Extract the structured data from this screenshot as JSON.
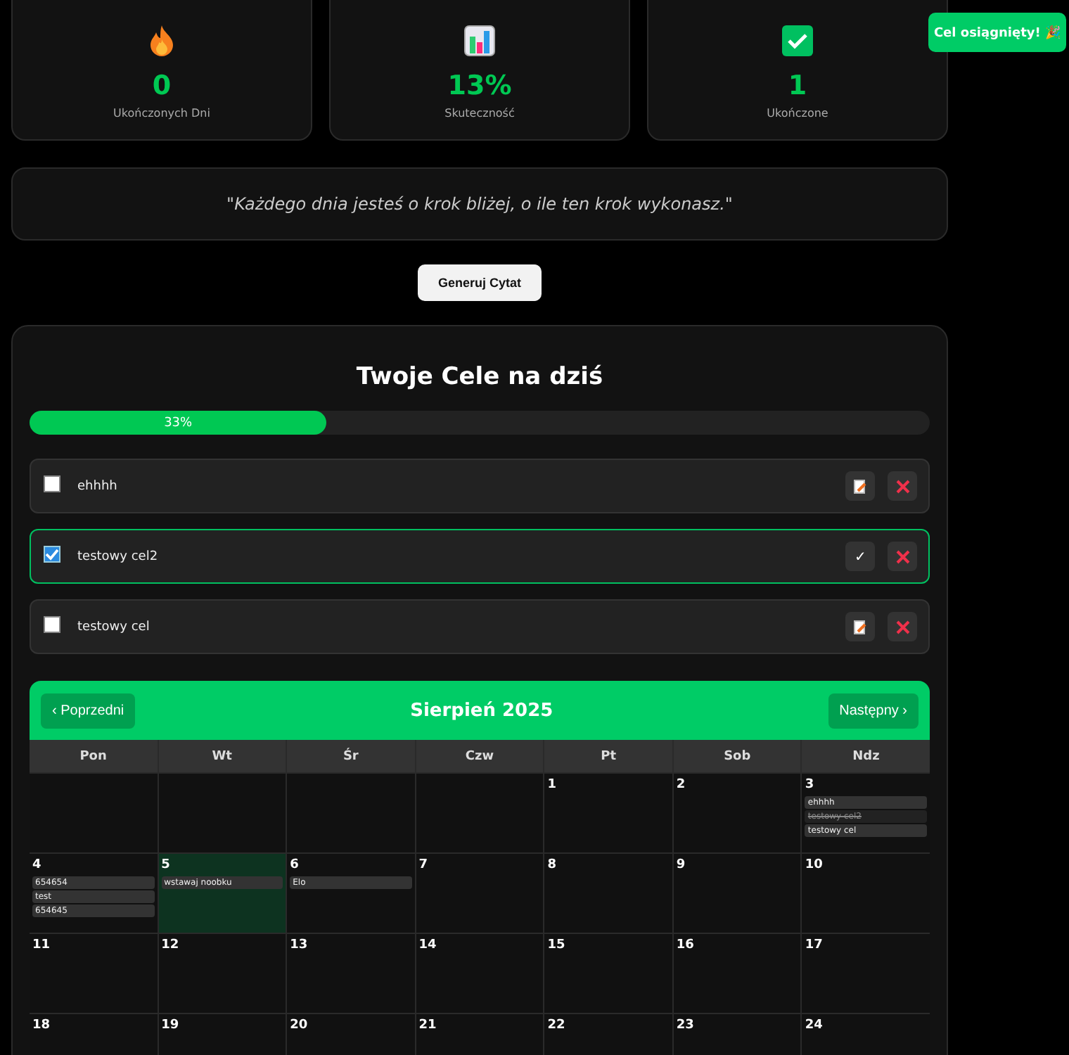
{
  "stats": [
    {
      "kind": "flame",
      "value": "0",
      "label": "Ukończonych Dni"
    },
    {
      "kind": "chart",
      "value": "13%",
      "label": "Skuteczność"
    },
    {
      "kind": "check",
      "value": "1",
      "label": "Ukończone"
    }
  ],
  "toast": {
    "text": "Cel osiągnięty! 🎉"
  },
  "quote": {
    "text": "\"Każdego dnia jesteś o krok bliżej, o ile ten krok wykonasz.\""
  },
  "quote_button": "Generuj Cytat",
  "goals_panel": {
    "title": "Twoje Cele na dziś",
    "progress": {
      "level": 0.33,
      "label": "33%"
    },
    "goals": [
      {
        "text": "ehhhh",
        "checked": false
      },
      {
        "text": "testowy cel2",
        "checked": true,
        "done_mark": "✓"
      },
      {
        "text": "testowy cel",
        "checked": false
      }
    ]
  },
  "calendar": {
    "title": "Sierpień 2025",
    "prev": "‹ Poprzedni",
    "next": "Następny ›",
    "weekdays": [
      "Pon",
      "Wt",
      "Śr",
      "Czw",
      "Pt",
      "Sob",
      "Ndz"
    ],
    "weeks": [
      [
        {
          "kind": "blank"
        },
        {
          "kind": "blank"
        },
        {
          "kind": "blank"
        },
        {
          "kind": "blank"
        },
        {
          "kind": "day",
          "day": "1",
          "today": false
        },
        {
          "kind": "day",
          "day": "2",
          "today": false
        },
        {
          "kind": "day",
          "day": "3",
          "today": false,
          "tasks": [
            {
              "text": "ehhhh",
              "done": false
            },
            {
              "text": "testowy cel2",
              "done": true
            },
            {
              "text": "testowy cel",
              "done": false
            }
          ]
        }
      ],
      [
        {
          "kind": "day",
          "day": "4",
          "today": false,
          "tasks": [
            {
              "text": "654654",
              "done": false
            },
            {
              "text": "test",
              "done": false
            },
            {
              "text": "654645",
              "done": false
            }
          ]
        },
        {
          "kind": "day",
          "day": "5",
          "today": true,
          "tasks": [
            {
              "text": "wstawaj noobku",
              "done": false
            }
          ]
        },
        {
          "kind": "day",
          "day": "6",
          "today": false,
          "tasks": [
            {
              "text": "Elo",
              "done": false
            }
          ]
        },
        {
          "kind": "day",
          "day": "7",
          "today": false
        },
        {
          "kind": "day",
          "day": "8",
          "today": false
        },
        {
          "kind": "day",
          "day": "9",
          "today": false
        },
        {
          "kind": "day",
          "day": "10",
          "today": false
        }
      ],
      [
        {
          "kind": "day",
          "day": "11",
          "today": false
        },
        {
          "kind": "day",
          "day": "12",
          "today": false
        },
        {
          "kind": "day",
          "day": "13",
          "today": false
        },
        {
          "kind": "day",
          "day": "14",
          "today": false
        },
        {
          "kind": "day",
          "day": "15",
          "today": false
        },
        {
          "kind": "day",
          "day": "16",
          "today": false
        },
        {
          "kind": "day",
          "day": "17",
          "today": false
        }
      ],
      [
        {
          "kind": "day",
          "day": "18",
          "today": false
        },
        {
          "kind": "day",
          "day": "19",
          "today": false
        },
        {
          "kind": "day",
          "day": "20",
          "today": false
        },
        {
          "kind": "day",
          "day": "21",
          "today": false
        },
        {
          "kind": "day",
          "day": "22",
          "today": false
        },
        {
          "kind": "day",
          "day": "23",
          "today": false
        },
        {
          "kind": "day",
          "day": "24",
          "today": false
        }
      ]
    ]
  }
}
